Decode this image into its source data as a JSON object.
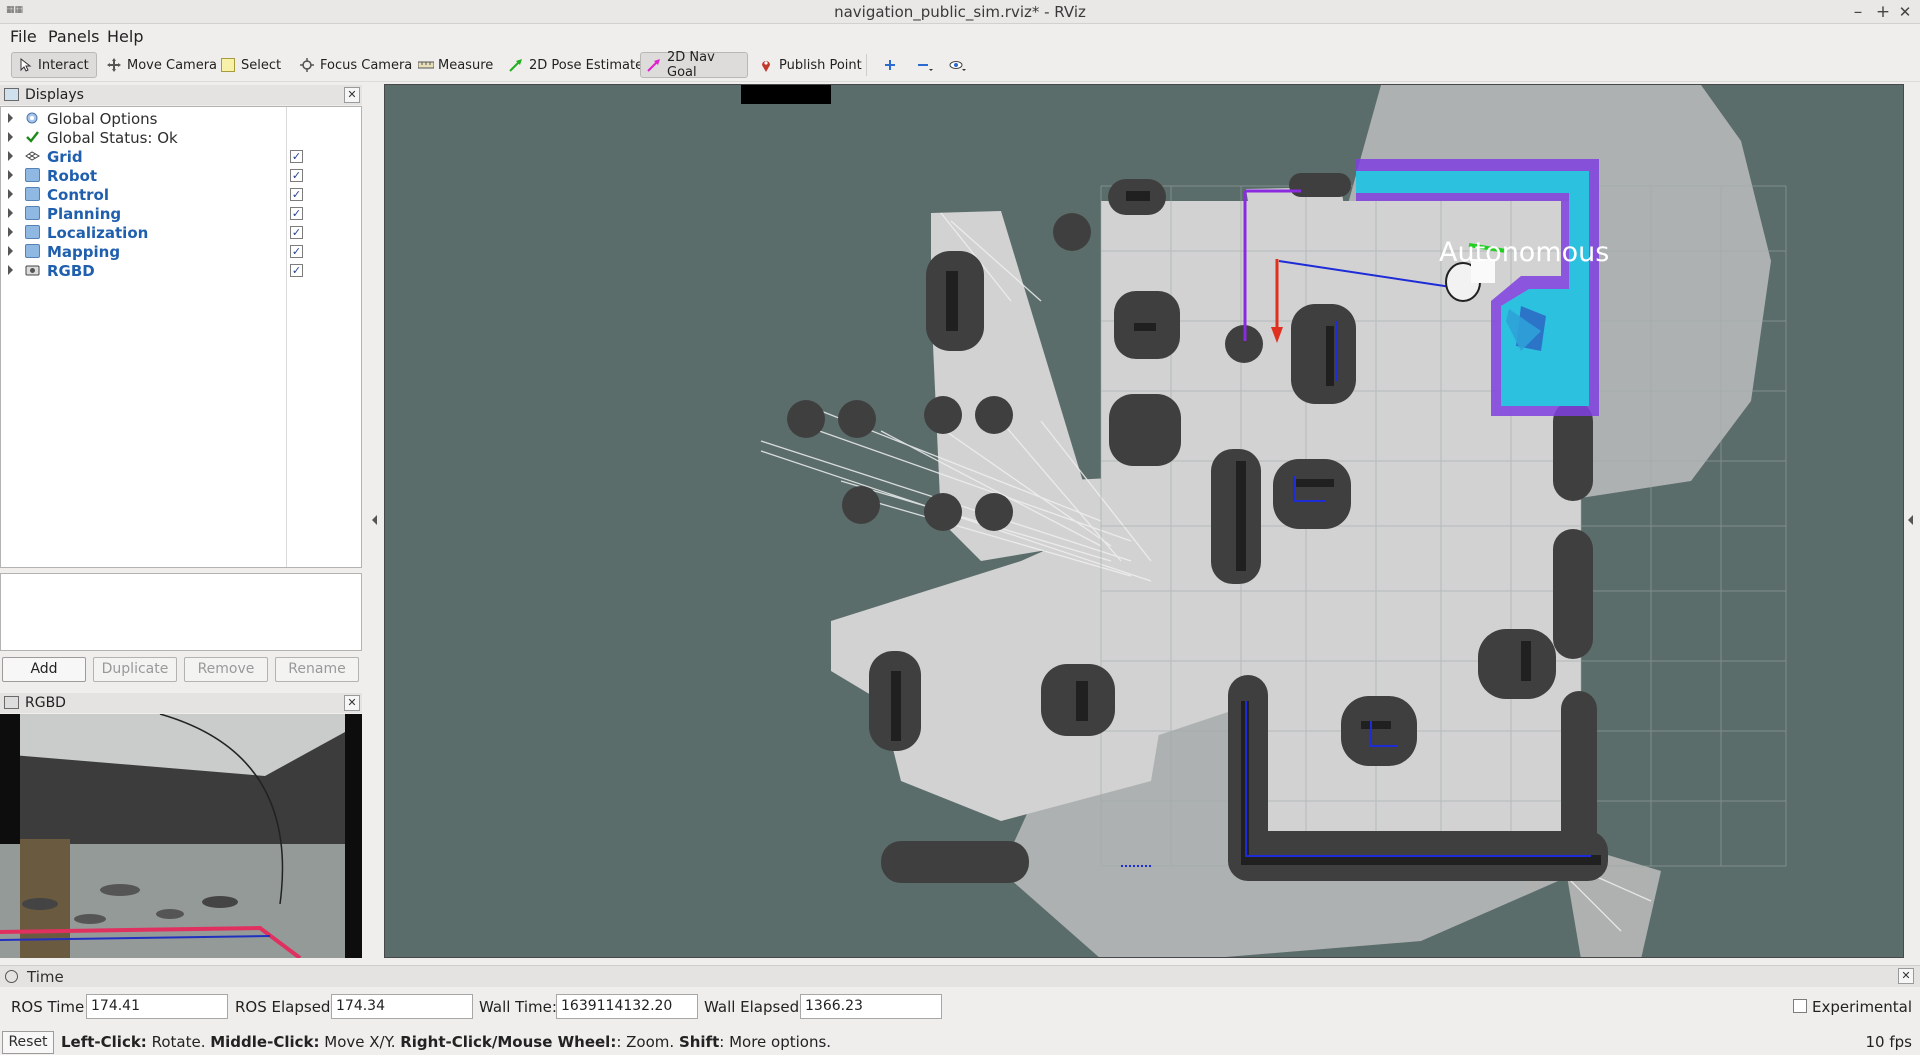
{
  "window": {
    "title": "navigation_public_sim.rviz* - RViz",
    "minimize": "–",
    "maximize": "+",
    "close": "✕"
  },
  "menu": {
    "file": "File",
    "panels": "Panels",
    "help": "Help"
  },
  "toolbar": {
    "interact": "Interact",
    "move_camera": "Move Camera",
    "select": "Select",
    "focus_camera": "Focus Camera",
    "measure": "Measure",
    "pose_estimate": "2D Pose Estimate",
    "nav_goal": "2D Nav Goal",
    "publish_point": "Publish Point",
    "active_tool": "2D Nav Goal"
  },
  "displays_panel": {
    "title": "Displays",
    "items": [
      {
        "label": "Global Options",
        "style": "normal",
        "checked": null
      },
      {
        "label": "Global Status: Ok",
        "style": "normal",
        "checked": null
      },
      {
        "label": "Grid",
        "style": "blue",
        "checked": true
      },
      {
        "label": "Robot",
        "style": "blue",
        "checked": true
      },
      {
        "label": "Control",
        "style": "blue",
        "checked": true
      },
      {
        "label": "Planning",
        "style": "blue",
        "checked": true
      },
      {
        "label": "Localization",
        "style": "blue",
        "checked": true
      },
      {
        "label": "Mapping",
        "style": "blue",
        "checked": true
      },
      {
        "label": "RGBD",
        "style": "blue",
        "checked": true
      }
    ],
    "buttons": {
      "add": "Add",
      "duplicate": "Duplicate",
      "remove": "Remove",
      "rename": "Rename"
    }
  },
  "rgbd_panel": {
    "title": "RGBD"
  },
  "viewport": {
    "overlay_text": "Autonomous"
  },
  "time_panel": {
    "title": "Time",
    "ros_time_label": "ROS Time:",
    "ros_time": "174.41",
    "ros_elapsed_label": "ROS Elapsed:",
    "ros_elapsed": "174.34",
    "wall_time_label": "Wall Time:",
    "wall_time": "1639114132.20",
    "wall_elapsed_label": "Wall Elapsed:",
    "wall_elapsed": "1366.23",
    "experimental_label": "Experimental",
    "experimental_checked": false
  },
  "status_bar": {
    "reset": "Reset",
    "left_click": "Left-Click:",
    "left_click_desc": " Rotate. ",
    "middle_click": "Middle-Click:",
    "middle_click_desc": " Move X/Y. ",
    "right_click": "Right-Click/Mouse Wheel:",
    "right_click_desc": ": Zoom. ",
    "shift": "Shift",
    "shift_desc": ": More options.",
    "fps": "10 fps"
  },
  "colors": {
    "viewport_bg": "#5b6d6b",
    "free_space": "#c9c9c9",
    "obstacle": "#2a2a2a",
    "inflation": "#444444",
    "costmap_cyan": "#16c8d2",
    "costmap_purple": "#8040e0",
    "path_blue": "#1e2cd8",
    "goal_red": "#e03020",
    "link_blue": "#1f5fad"
  }
}
